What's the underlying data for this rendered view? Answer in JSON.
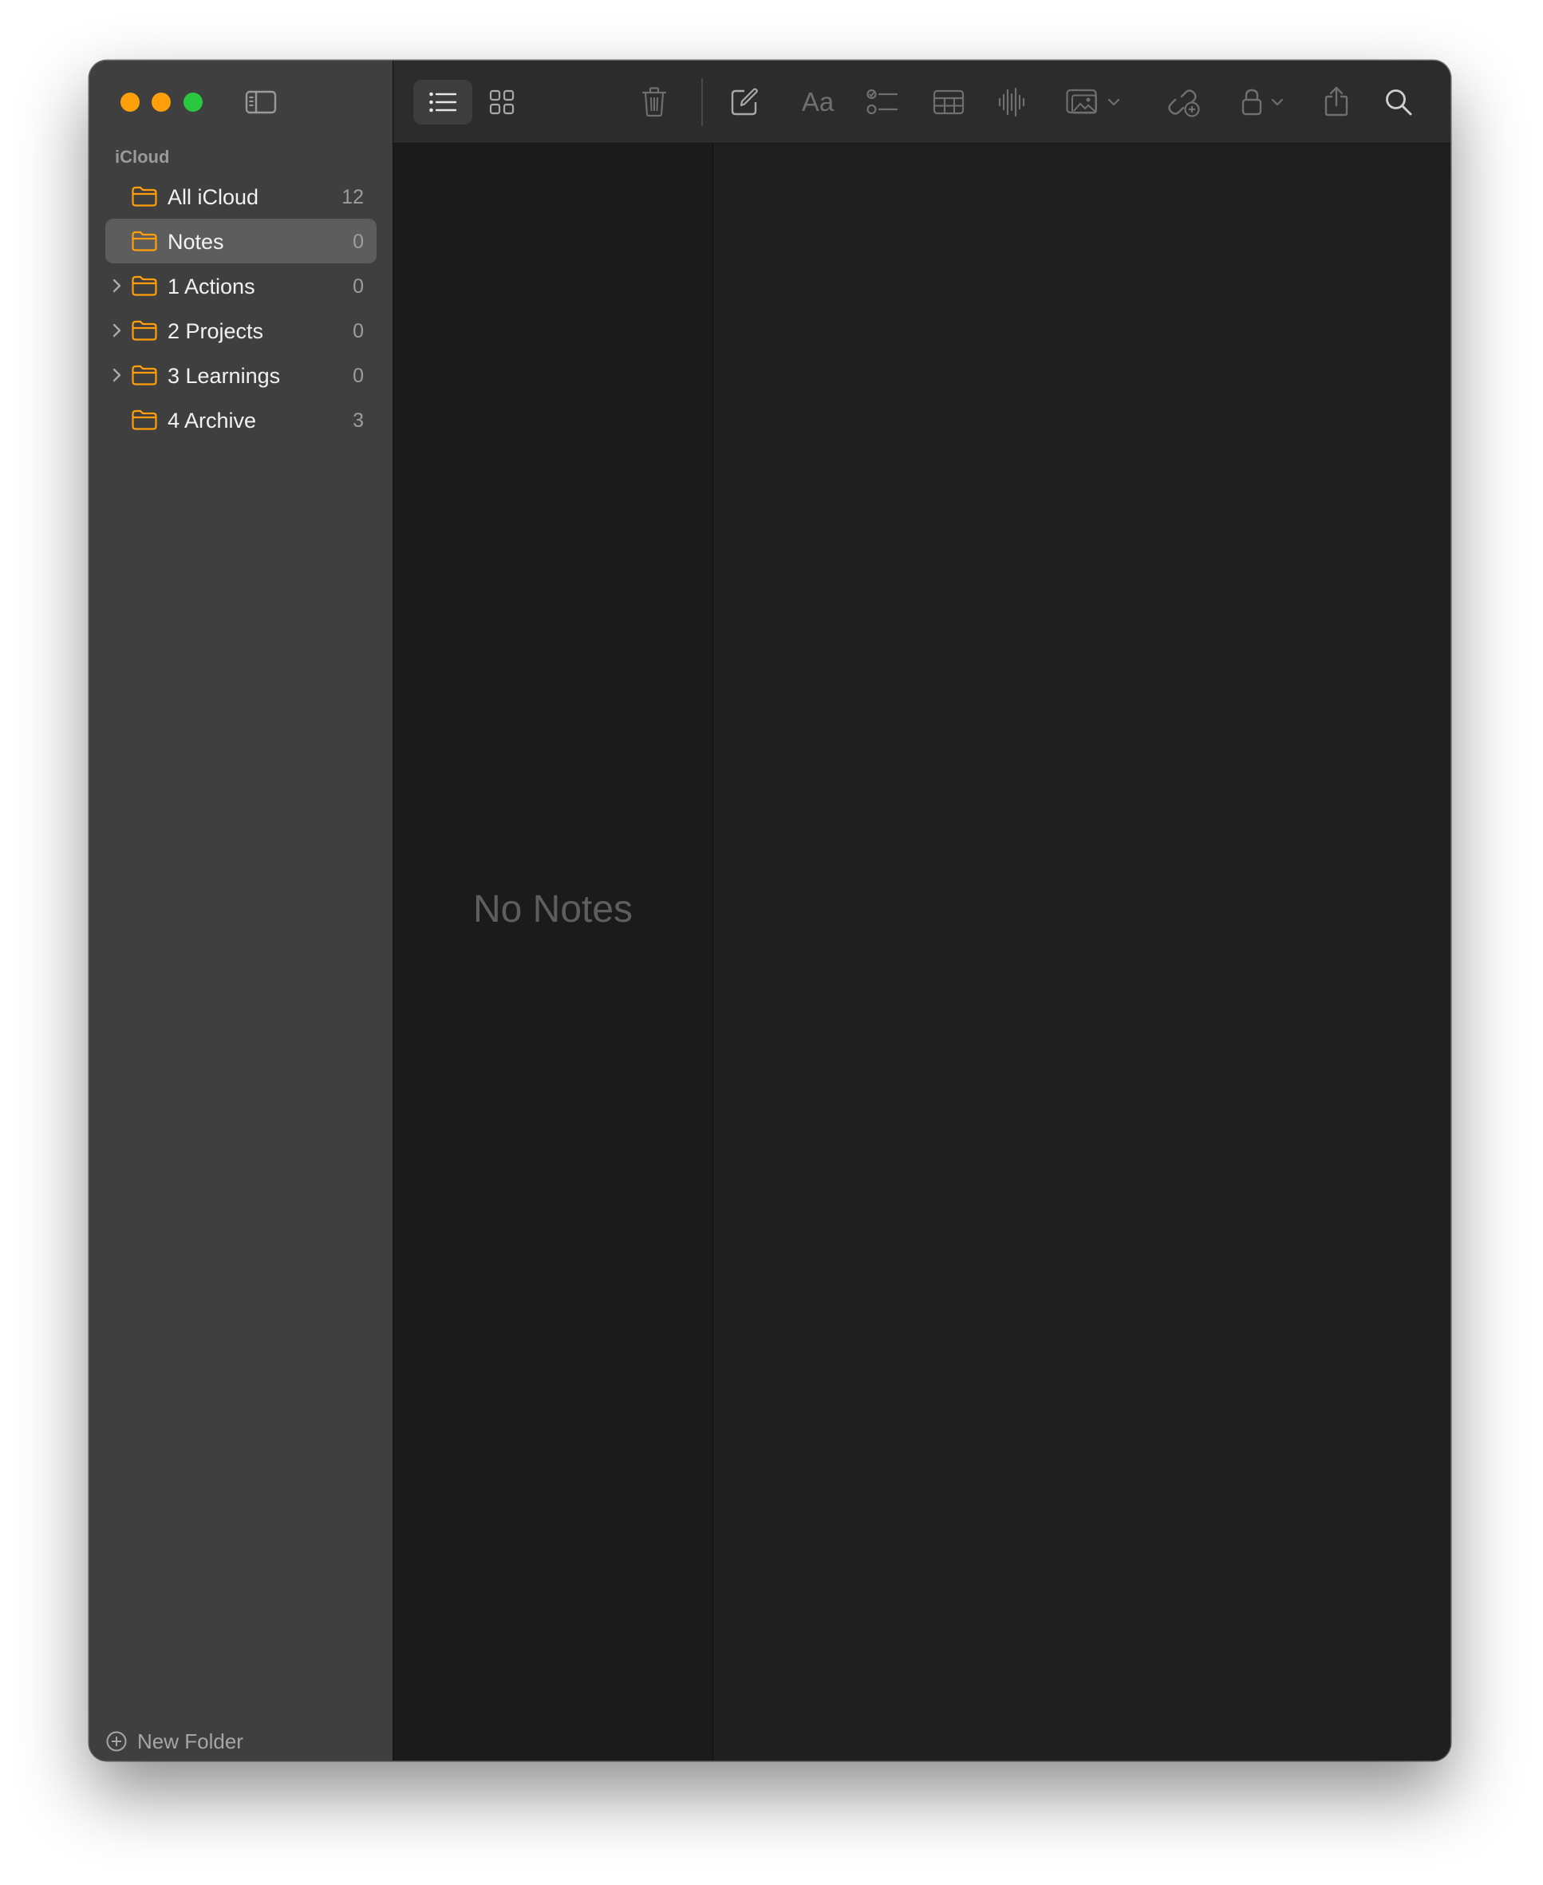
{
  "sidebar": {
    "section_label": "iCloud",
    "folders": [
      {
        "label": "All iCloud",
        "count": "12",
        "expandable": false,
        "selected": false
      },
      {
        "label": "Notes",
        "count": "0",
        "expandable": false,
        "selected": true
      },
      {
        "label": "1 Actions",
        "count": "0",
        "expandable": true,
        "selected": false
      },
      {
        "label": "2 Projects",
        "count": "0",
        "expandable": true,
        "selected": false
      },
      {
        "label": "3 Learnings",
        "count": "0",
        "expandable": true,
        "selected": false
      },
      {
        "label": "4 Archive",
        "count": "3",
        "expandable": false,
        "selected": false
      }
    ],
    "new_folder_label": "New Folder"
  },
  "toolbar": {
    "format_label": "Aa",
    "icons": [
      "list-view-icon",
      "gallery-view-icon",
      "trash-icon",
      "compose-icon",
      "format-icon",
      "checklist-icon",
      "table-icon",
      "audio-icon",
      "media-icon",
      "collaborate-icon",
      "lock-icon",
      "share-icon",
      "search-icon"
    ]
  },
  "note_list": {
    "empty_label": "No Notes"
  },
  "colors": {
    "accent": "#ff9f0a",
    "close": "#ff9f0a",
    "minimize": "#ff9f0a",
    "zoom": "#29c840",
    "sidebar_bg": "#3f3f3f",
    "selected_bg": "#5d5d5d",
    "toolbar_bg": "#2c2c2c",
    "list_bg": "#1b1b1b",
    "editor_bg": "#1f1f1f"
  }
}
